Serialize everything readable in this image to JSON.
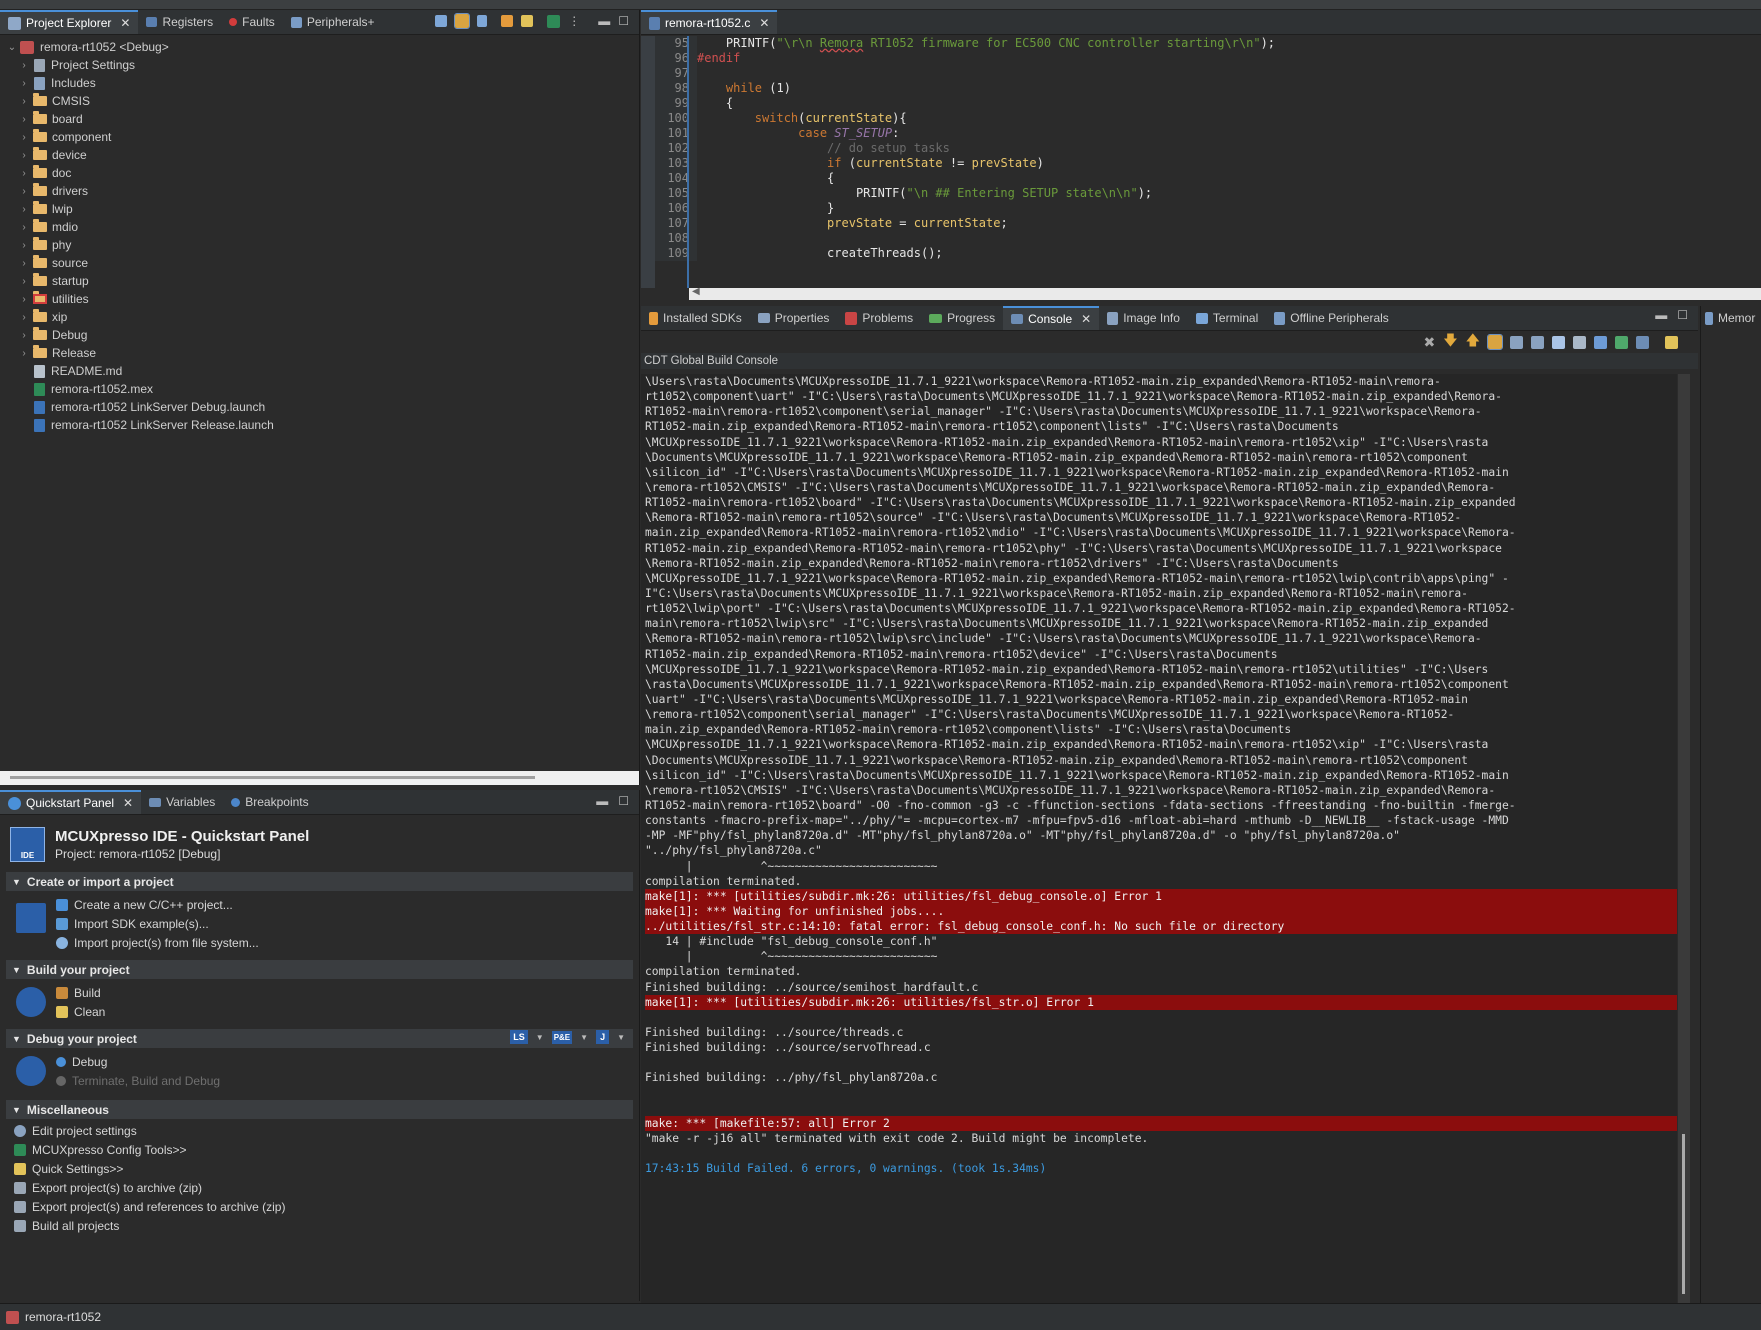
{
  "colors": {
    "accent": "#4a90d9",
    "error_bg": "#8b0d0d",
    "info": "#3c9be0",
    "folder": "#e8b86b"
  },
  "explorer": {
    "tabs": [
      {
        "label": "Project Explorer",
        "icon": "project-explorer-icon"
      },
      {
        "label": "Registers",
        "icon": "registers-icon"
      },
      {
        "label": "Faults",
        "icon": "faults-icon"
      },
      {
        "label": "Peripherals+",
        "icon": "peripherals-icon"
      }
    ],
    "root": "remora-rt1052 <Debug>",
    "items": [
      {
        "label": "Project Settings",
        "kind": "settings"
      },
      {
        "label": "Includes",
        "kind": "includes"
      },
      {
        "label": "CMSIS",
        "kind": "folder"
      },
      {
        "label": "board",
        "kind": "folder"
      },
      {
        "label": "component",
        "kind": "folder"
      },
      {
        "label": "device",
        "kind": "folder"
      },
      {
        "label": "doc",
        "kind": "folder"
      },
      {
        "label": "drivers",
        "kind": "folder"
      },
      {
        "label": "lwip",
        "kind": "folder"
      },
      {
        "label": "mdio",
        "kind": "folder"
      },
      {
        "label": "phy",
        "kind": "folder"
      },
      {
        "label": "source",
        "kind": "folder"
      },
      {
        "label": "startup",
        "kind": "folder"
      },
      {
        "label": "utilities",
        "kind": "folder-error"
      },
      {
        "label": "xip",
        "kind": "folder"
      },
      {
        "label": "Debug",
        "kind": "folder"
      },
      {
        "label": "Release",
        "kind": "folder"
      },
      {
        "label": "README.md",
        "kind": "file"
      },
      {
        "label": "remora-rt1052.mex",
        "kind": "mex"
      },
      {
        "label": "remora-rt1052 LinkServer Debug.launch",
        "kind": "launch"
      },
      {
        "label": "remora-rt1052 LinkServer Release.launch",
        "kind": "launch"
      }
    ]
  },
  "quickstart": {
    "tabs": [
      {
        "label": "Quickstart Panel",
        "icon": "quickstart-icon"
      },
      {
        "label": "Variables",
        "icon": "variables-icon"
      },
      {
        "label": "Breakpoints",
        "icon": "breakpoints-icon"
      }
    ],
    "title": "MCUXpresso IDE - Quickstart Panel",
    "project": "Project: remora-rt1052 [Debug]",
    "logo_text": "IDE",
    "sections": {
      "create": {
        "title": "Create or import a project",
        "links": [
          "Create a new C/C++ project...",
          "Import SDK example(s)...",
          "Import project(s) from file system..."
        ]
      },
      "build": {
        "title": "Build your project",
        "links": [
          "Build",
          "Clean"
        ]
      },
      "debug": {
        "title": "Debug your project",
        "links": [
          "Debug",
          "Terminate, Build and Debug"
        ],
        "probes": [
          "LS",
          "P&E",
          "J"
        ]
      },
      "misc": {
        "title": "Miscellaneous",
        "links": [
          "Edit project settings",
          "MCUXpresso Config Tools>>",
          "Quick Settings>>",
          "Export project(s) to archive (zip)",
          "Export project(s) and references to archive (zip)",
          "Build all projects"
        ]
      }
    }
  },
  "editor": {
    "tab": "remora-rt1052.c",
    "lines": [
      {
        "n": "95",
        "segs": [
          [
            "    ",
            "plain"
          ],
          [
            "PRINTF",
            "plain"
          ],
          [
            "(",
            "plain"
          ],
          [
            "\"\\r\\n ",
            "str"
          ],
          [
            "Remora",
            "strul"
          ],
          [
            " RT1052 firmware for EC500 CNC controller starting\\r\\n\"",
            "str"
          ],
          [
            ");",
            "plain"
          ]
        ]
      },
      {
        "n": "96",
        "segs": [
          [
            "#endif",
            "pp"
          ]
        ]
      },
      {
        "n": "97",
        "segs": [
          [
            "",
            "plain"
          ]
        ]
      },
      {
        "n": "98",
        "segs": [
          [
            "    ",
            "plain"
          ],
          [
            "while",
            "kw"
          ],
          [
            " (",
            "plain"
          ],
          [
            "1",
            "num"
          ],
          [
            ")",
            "plain"
          ]
        ]
      },
      {
        "n": "99",
        "segs": [
          [
            "    {",
            "plain"
          ]
        ]
      },
      {
        "n": "100",
        "segs": [
          [
            "        ",
            "plain"
          ],
          [
            "switch",
            "kw"
          ],
          [
            "(",
            "plain"
          ],
          [
            "currentState",
            "var"
          ],
          [
            "){",
            "plain"
          ]
        ]
      },
      {
        "n": "101",
        "segs": [
          [
            "              ",
            "plain"
          ],
          [
            "case",
            "kw"
          ],
          [
            " ",
            "plain"
          ],
          [
            "ST_SETUP",
            "const"
          ],
          [
            ":",
            "plain"
          ]
        ]
      },
      {
        "n": "102",
        "segs": [
          [
            "                  ",
            "plain"
          ],
          [
            "// do setup tasks",
            "cmt"
          ]
        ]
      },
      {
        "n": "103",
        "segs": [
          [
            "                  ",
            "plain"
          ],
          [
            "if",
            "kw"
          ],
          [
            " (",
            "plain"
          ],
          [
            "currentState",
            "var"
          ],
          [
            " != ",
            "plain"
          ],
          [
            "prevState",
            "var"
          ],
          [
            ")",
            "plain"
          ]
        ]
      },
      {
        "n": "104",
        "segs": [
          [
            "                  {",
            "plain"
          ]
        ]
      },
      {
        "n": "105",
        "segs": [
          [
            "                      PRINTF(",
            "plain"
          ],
          [
            "\"\\n ## Entering SETUP state\\n\\n\"",
            "str"
          ],
          [
            ");",
            "plain"
          ]
        ]
      },
      {
        "n": "106",
        "segs": [
          [
            "                  }",
            "plain"
          ]
        ]
      },
      {
        "n": "107",
        "segs": [
          [
            "                  ",
            "plain"
          ],
          [
            "prevState",
            "var"
          ],
          [
            " = ",
            "plain"
          ],
          [
            "currentState",
            "var"
          ],
          [
            ";",
            "plain"
          ]
        ]
      },
      {
        "n": "108",
        "segs": [
          [
            "",
            "plain"
          ]
        ]
      },
      {
        "n": "109",
        "segs": [
          [
            "                  createThreads();",
            "plain"
          ]
        ]
      }
    ]
  },
  "console": {
    "tabs": [
      {
        "label": "Installed SDKs",
        "icon": "sdk-icon"
      },
      {
        "label": "Properties",
        "icon": "properties-icon"
      },
      {
        "label": "Problems",
        "icon": "problems-icon"
      },
      {
        "label": "Progress",
        "icon": "progress-icon"
      },
      {
        "label": "Console",
        "icon": "console-icon"
      },
      {
        "label": "Image Info",
        "icon": "image-info-icon"
      },
      {
        "label": "Terminal",
        "icon": "terminal-icon"
      },
      {
        "label": "Offline Peripherals",
        "icon": "offline-peripherals-icon"
      }
    ],
    "header": "CDT Global Build Console",
    "right_tab": "Memor",
    "lines": [
      {
        "t": "\\Users\\rasta\\Documents\\MCUXpressoIDE_11.7.1_9221\\workspace\\Remora-RT1052-main.zip_expanded\\Remora-RT1052-main\\remora-",
        "k": ""
      },
      {
        "t": "rt1052\\component\\uart\" -I\"C:\\Users\\rasta\\Documents\\MCUXpressoIDE_11.7.1_9221\\workspace\\Remora-RT1052-main.zip_expanded\\Remora-",
        "k": ""
      },
      {
        "t": "RT1052-main\\remora-rt1052\\component\\serial_manager\" -I\"C:\\Users\\rasta\\Documents\\MCUXpressoIDE_11.7.1_9221\\workspace\\Remora-",
        "k": ""
      },
      {
        "t": "RT1052-main.zip_expanded\\Remora-RT1052-main\\remora-rt1052\\component\\lists\" -I\"C:\\Users\\rasta\\Documents",
        "k": ""
      },
      {
        "t": "\\MCUXpressoIDE_11.7.1_9221\\workspace\\Remora-RT1052-main.zip_expanded\\Remora-RT1052-main\\remora-rt1052\\xip\" -I\"C:\\Users\\rasta",
        "k": ""
      },
      {
        "t": "\\Documents\\MCUXpressoIDE_11.7.1_9221\\workspace\\Remora-RT1052-main.zip_expanded\\Remora-RT1052-main\\remora-rt1052\\component",
        "k": ""
      },
      {
        "t": "\\silicon_id\" -I\"C:\\Users\\rasta\\Documents\\MCUXpressoIDE_11.7.1_9221\\workspace\\Remora-RT1052-main.zip_expanded\\Remora-RT1052-main",
        "k": ""
      },
      {
        "t": "\\remora-rt1052\\CMSIS\" -I\"C:\\Users\\rasta\\Documents\\MCUXpressoIDE_11.7.1_9221\\workspace\\Remora-RT1052-main.zip_expanded\\Remora-",
        "k": ""
      },
      {
        "t": "RT1052-main\\remora-rt1052\\board\" -I\"C:\\Users\\rasta\\Documents\\MCUXpressoIDE_11.7.1_9221\\workspace\\Remora-RT1052-main.zip_expanded",
        "k": ""
      },
      {
        "t": "\\Remora-RT1052-main\\remora-rt1052\\source\" -I\"C:\\Users\\rasta\\Documents\\MCUXpressoIDE_11.7.1_9221\\workspace\\Remora-RT1052-",
        "k": ""
      },
      {
        "t": "main.zip_expanded\\Remora-RT1052-main\\remora-rt1052\\mdio\" -I\"C:\\Users\\rasta\\Documents\\MCUXpressoIDE_11.7.1_9221\\workspace\\Remora-",
        "k": ""
      },
      {
        "t": "RT1052-main.zip_expanded\\Remora-RT1052-main\\remora-rt1052\\phy\" -I\"C:\\Users\\rasta\\Documents\\MCUXpressoIDE_11.7.1_9221\\workspace",
        "k": ""
      },
      {
        "t": "\\Remora-RT1052-main.zip_expanded\\Remora-RT1052-main\\remora-rt1052\\drivers\" -I\"C:\\Users\\rasta\\Documents",
        "k": ""
      },
      {
        "t": "\\MCUXpressoIDE_11.7.1_9221\\workspace\\Remora-RT1052-main.zip_expanded\\Remora-RT1052-main\\remora-rt1052\\lwip\\contrib\\apps\\ping\" -",
        "k": ""
      },
      {
        "t": "I\"C:\\Users\\rasta\\Documents\\MCUXpressoIDE_11.7.1_9221\\workspace\\Remora-RT1052-main.zip_expanded\\Remora-RT1052-main\\remora-",
        "k": ""
      },
      {
        "t": "rt1052\\lwip\\port\" -I\"C:\\Users\\rasta\\Documents\\MCUXpressoIDE_11.7.1_9221\\workspace\\Remora-RT1052-main.zip_expanded\\Remora-RT1052-",
        "k": ""
      },
      {
        "t": "main\\remora-rt1052\\lwip\\src\" -I\"C:\\Users\\rasta\\Documents\\MCUXpressoIDE_11.7.1_9221\\workspace\\Remora-RT1052-main.zip_expanded",
        "k": ""
      },
      {
        "t": "\\Remora-RT1052-main\\remora-rt1052\\lwip\\src\\include\" -I\"C:\\Users\\rasta\\Documents\\MCUXpressoIDE_11.7.1_9221\\workspace\\Remora-",
        "k": ""
      },
      {
        "t": "RT1052-main.zip_expanded\\Remora-RT1052-main\\remora-rt1052\\device\" -I\"C:\\Users\\rasta\\Documents",
        "k": ""
      },
      {
        "t": "\\MCUXpressoIDE_11.7.1_9221\\workspace\\Remora-RT1052-main.zip_expanded\\Remora-RT1052-main\\remora-rt1052\\utilities\" -I\"C:\\Users",
        "k": ""
      },
      {
        "t": "\\rasta\\Documents\\MCUXpressoIDE_11.7.1_9221\\workspace\\Remora-RT1052-main.zip_expanded\\Remora-RT1052-main\\remora-rt1052\\component",
        "k": ""
      },
      {
        "t": "\\uart\" -I\"C:\\Users\\rasta\\Documents\\MCUXpressoIDE_11.7.1_9221\\workspace\\Remora-RT1052-main.zip_expanded\\Remora-RT1052-main",
        "k": ""
      },
      {
        "t": "\\remora-rt1052\\component\\serial_manager\" -I\"C:\\Users\\rasta\\Documents\\MCUXpressoIDE_11.7.1_9221\\workspace\\Remora-RT1052-",
        "k": ""
      },
      {
        "t": "main.zip_expanded\\Remora-RT1052-main\\remora-rt1052\\component\\lists\" -I\"C:\\Users\\rasta\\Documents",
        "k": ""
      },
      {
        "t": "\\MCUXpressoIDE_11.7.1_9221\\workspace\\Remora-RT1052-main.zip_expanded\\Remora-RT1052-main\\remora-rt1052\\xip\" -I\"C:\\Users\\rasta",
        "k": ""
      },
      {
        "t": "\\Documents\\MCUXpressoIDE_11.7.1_9221\\workspace\\Remora-RT1052-main.zip_expanded\\Remora-RT1052-main\\remora-rt1052\\component",
        "k": ""
      },
      {
        "t": "\\silicon_id\" -I\"C:\\Users\\rasta\\Documents\\MCUXpressoIDE_11.7.1_9221\\workspace\\Remora-RT1052-main.zip_expanded\\Remora-RT1052-main",
        "k": ""
      },
      {
        "t": "\\remora-rt1052\\CMSIS\" -I\"C:\\Users\\rasta\\Documents\\MCUXpressoIDE_11.7.1_9221\\workspace\\Remora-RT1052-main.zip_expanded\\Remora-",
        "k": ""
      },
      {
        "t": "RT1052-main\\remora-rt1052\\board\" -O0 -fno-common -g3 -c -ffunction-sections -fdata-sections -ffreestanding -fno-builtin -fmerge-",
        "k": ""
      },
      {
        "t": "constants -fmacro-prefix-map=\"../phy/\"= -mcpu=cortex-m7 -mfpu=fpv5-d16 -mfloat-abi=hard -mthumb -D__NEWLIB__ -fstack-usage -MMD",
        "k": ""
      },
      {
        "t": "-MP -MF\"phy/fsl_phylan8720a.d\" -MT\"phy/fsl_phylan8720a.o\" -MT\"phy/fsl_phylan8720a.d\" -o \"phy/fsl_phylan8720a.o\"",
        "k": ""
      },
      {
        "t": "\"../phy/fsl_phylan8720a.c\"",
        "k": ""
      },
      {
        "t": "      |          ^~~~~~~~~~~~~~~~~~~~~~~~~~",
        "k": ""
      },
      {
        "t": "compilation terminated.",
        "k": ""
      },
      {
        "t": "make[1]: *** [utilities/subdir.mk:26: utilities/fsl_debug_console.o] Error 1",
        "k": "err"
      },
      {
        "t": "make[1]: *** Waiting for unfinished jobs....",
        "k": "err"
      },
      {
        "t": "../utilities/fsl_str.c:14:10: fatal error: fsl_debug_console_conf.h: No such file or directory",
        "k": "err"
      },
      {
        "t": "   14 | #include \"fsl_debug_console_conf.h\"",
        "k": ""
      },
      {
        "t": "      |          ^~~~~~~~~~~~~~~~~~~~~~~~~~",
        "k": ""
      },
      {
        "t": "compilation terminated.",
        "k": ""
      },
      {
        "t": "Finished building: ../source/semihost_hardfault.c",
        "k": ""
      },
      {
        "t": "make[1]: *** [utilities/subdir.mk:26: utilities/fsl_str.o] Error 1",
        "k": "err"
      },
      {
        "t": " ",
        "k": ""
      },
      {
        "t": "Finished building: ../source/threads.c",
        "k": ""
      },
      {
        "t": "Finished building: ../source/servoThread.c",
        "k": ""
      },
      {
        "t": " ",
        "k": ""
      },
      {
        "t": "Finished building: ../phy/fsl_phylan8720a.c",
        "k": ""
      },
      {
        "t": " ",
        "k": ""
      },
      {
        "t": " ",
        "k": ""
      },
      {
        "t": "make: *** [makefile:57: all] Error 2",
        "k": "err"
      },
      {
        "t": "\"make -r -j16 all\" terminated with exit code 2. Build might be incomplete.",
        "k": ""
      },
      {
        "t": " ",
        "k": ""
      },
      {
        "t": "17:43:15 Build Failed. 6 errors, 0 warnings. (took 1s.34ms)",
        "k": "info"
      }
    ]
  },
  "statusbar": {
    "label": "remora-rt1052"
  }
}
